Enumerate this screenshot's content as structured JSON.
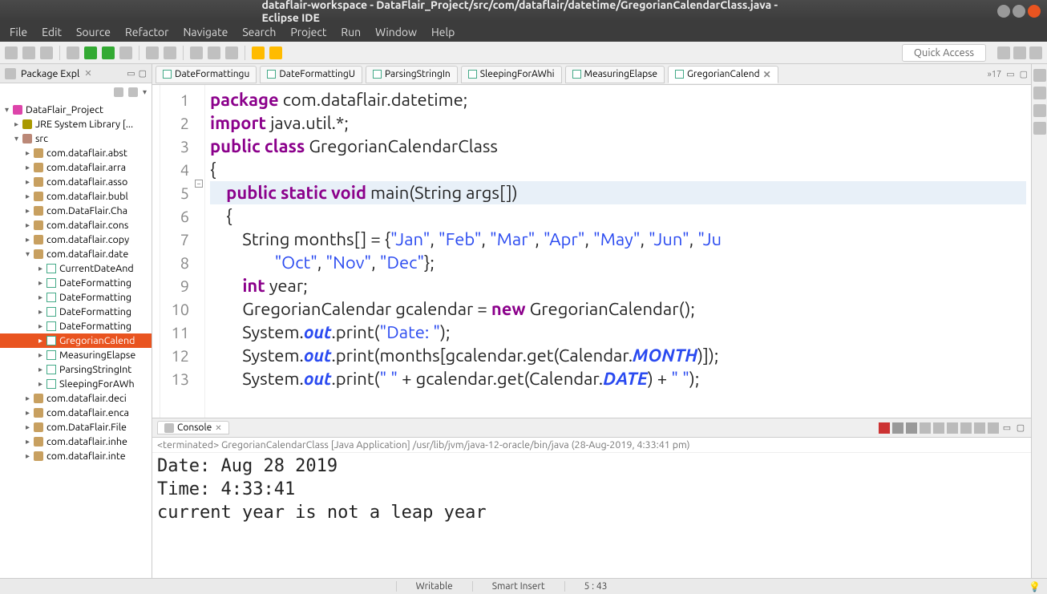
{
  "window": {
    "title": "dataflair-workspace - DataFlair_Project/src/com/dataflair/datetime/GregorianCalendarClass.java - Eclipse IDE"
  },
  "menubar": [
    "File",
    "Edit",
    "Source",
    "Refactor",
    "Navigate",
    "Search",
    "Project",
    "Run",
    "Window",
    "Help"
  ],
  "quick_access": "Quick Access",
  "sidebar": {
    "title": "Package Expl",
    "project": "DataFlair_Project",
    "lib": "JRE System Library [...",
    "src": "src",
    "packages": [
      "com.dataflair.abst",
      "com.dataflair.arra",
      "com.dataflair.asso",
      "com.dataflair.bubl",
      "com.DataFlair.Cha",
      "com.dataflair.cons",
      "com.dataflair.copy"
    ],
    "openpkg": "com.dataflair.date",
    "files": [
      "CurrentDateAnd",
      "DateFormatting",
      "DateFormatting",
      "DateFormatting",
      "DateFormatting",
      "GregorianCalend",
      "MeasuringElapse",
      "ParsingStringInt",
      "SleepingForAWh"
    ],
    "packages2": [
      "com.dataflair.deci",
      "com.dataflair.enca",
      "com.DataFlair.File",
      "com.dataflair.inhe",
      "com.dataflair.inte"
    ],
    "selected_file_index": 5
  },
  "tabs": [
    "DateFormattingu",
    "DateFormattingU",
    "ParsingStringIn",
    "SleepingForAWhi",
    "MeasuringElapse",
    "GregorianCalend"
  ],
  "active_tab_index": 5,
  "tab_overflow": "»17",
  "code": {
    "line_numbers": [
      "1",
      "2",
      "3",
      "4",
      "5",
      "6",
      "7",
      "8",
      "9",
      "10",
      "11",
      "12",
      "13"
    ],
    "l1_a": "package",
    "l1_b": " com.dataflair.datetime;",
    "l2_a": "import",
    "l2_b": " java.util.*;",
    "l3_a": "public",
    "l3_b": "class",
    "l3_c": " GregorianCalendarClass",
    "l4": "{",
    "l5_a": "public",
    "l5_b": "static",
    "l5_c": "void",
    "l5_d": " main(String args[])",
    "l6": "    {",
    "l7_a": "        String months[] = {",
    "l7_b": "\"Jan\"",
    "l7_c": ", ",
    "l7_d": "\"Feb\"",
    "l7_e": ", ",
    "l7_f": "\"Mar\"",
    "l7_g": ", ",
    "l7_h": "\"Apr\"",
    "l7_i": ", ",
    "l7_j": "\"May\"",
    "l7_k": ", ",
    "l7_l": "\"Jun\"",
    "l7_m": ", ",
    "l7_n": "\"Ju",
    "l8_a": "                ",
    "l8_b": "\"Oct\"",
    "l8_c": ", ",
    "l8_d": "\"Nov\"",
    "l8_e": ", ",
    "l8_f": "\"Dec\"",
    "l8_g": "};",
    "l9_a": "        ",
    "l9_b": "int",
    "l9_c": " year;",
    "l10_a": "        GregorianCalendar gcalendar = ",
    "l10_b": "new",
    "l10_c": " GregorianCalendar();",
    "l11_a": "        System.",
    "l11_b": "out",
    "l11_c": ".print(",
    "l11_d": "\"Date: \"",
    "l11_e": ");",
    "l12_a": "        System.",
    "l12_b": "out",
    "l12_c": ".print(months[gcalendar.get(Calendar.",
    "l12_d": "MONTH",
    "l12_e": ")]);",
    "l13_a": "        System.",
    "l13_b": "out",
    "l13_c": ".print(",
    "l13_d": "\" \"",
    "l13_e": " + gcalendar.get(Calendar.",
    "l13_f": "DATE",
    "l13_g": ") + ",
    "l13_h": "\" \"",
    "l13_i": ");"
  },
  "console": {
    "tab": "Console",
    "status": "<terminated> GregorianCalendarClass [Java Application] /usr/lib/jvm/java-12-oracle/bin/java (28-Aug-2019, 4:33:41 pm)",
    "output": "Date: Aug 28 2019\nTime: 4:33:41\ncurrent year is not a leap year"
  },
  "statusbar": {
    "writable": "Writable",
    "insert": "Smart Insert",
    "pos": "5 : 43"
  }
}
